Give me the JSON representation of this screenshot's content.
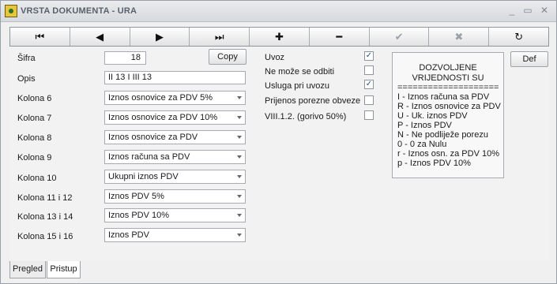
{
  "window": {
    "title": "VRSTA DOKUMENTA - URA"
  },
  "toolbar": {
    "buttons": [
      {
        "icon": "first-record-icon",
        "glyph": "⏮"
      },
      {
        "icon": "previous-record-icon",
        "glyph": "◀"
      },
      {
        "icon": "next-record-icon",
        "glyph": "▶"
      },
      {
        "icon": "last-record-icon",
        "glyph": "⏭"
      },
      {
        "icon": "add-icon",
        "glyph": "✚"
      },
      {
        "icon": "delete-icon",
        "glyph": "━"
      },
      {
        "icon": "confirm-icon",
        "glyph": "✔"
      },
      {
        "icon": "cancel-icon",
        "glyph": "✖"
      },
      {
        "icon": "refresh-icon",
        "glyph": "↻"
      }
    ]
  },
  "form": {
    "sifra_label": "Šifra",
    "sifra_value": "18",
    "copy_label": "Copy",
    "opis_label": "Opis",
    "opis_value": "II 13 I III 13",
    "kolone": [
      {
        "label": "Kolona 6",
        "value": "Iznos osnovice za PDV 5%"
      },
      {
        "label": "Kolona 7",
        "value": "Iznos osnovice za PDV 10%"
      },
      {
        "label": "Kolona 8",
        "value": "Iznos osnovice za PDV"
      },
      {
        "label": "Kolona 9",
        "value": "Iznos računa sa PDV"
      },
      {
        "label": "Kolona 10",
        "value": "Ukupni iznos PDV"
      },
      {
        "label": "Kolona 11 i 12",
        "value": "Iznos PDV 5%"
      },
      {
        "label": "Kolona 13 i 14",
        "value": "Iznos PDV 10%"
      },
      {
        "label": "Kolona 15 i 16",
        "value": "Iznos PDV"
      }
    ]
  },
  "checkboxes": [
    {
      "label": "Uvoz",
      "checked": true
    },
    {
      "label": "Ne može se odbiti",
      "checked": false
    },
    {
      "label": "Usluga pri uvozu",
      "checked": true
    },
    {
      "label": "Prijenos porezne obveze",
      "checked": false
    },
    {
      "label": "VIII.1.2. (gorivo 50%)",
      "checked": false
    }
  ],
  "info": {
    "title_line1": "DOZVOLJENE",
    "title_line2": "VRIJEDNOSTI SU",
    "separator": "====================",
    "lines": [
      "I  - Iznos računa sa PDV",
      "R - Iznos osnovice za PDV",
      "U - Uk. iznos PDV",
      "P - Iznos PDV",
      "N - Ne podliježe porezu",
      "0 - 0 za Nulu",
      "r - Iznos osn. za PDV 10%",
      "p - Iznos PDV 10%"
    ]
  },
  "def_label": "Def",
  "tabs": [
    {
      "label": "Pregled"
    },
    {
      "label": "Pristup"
    }
  ]
}
